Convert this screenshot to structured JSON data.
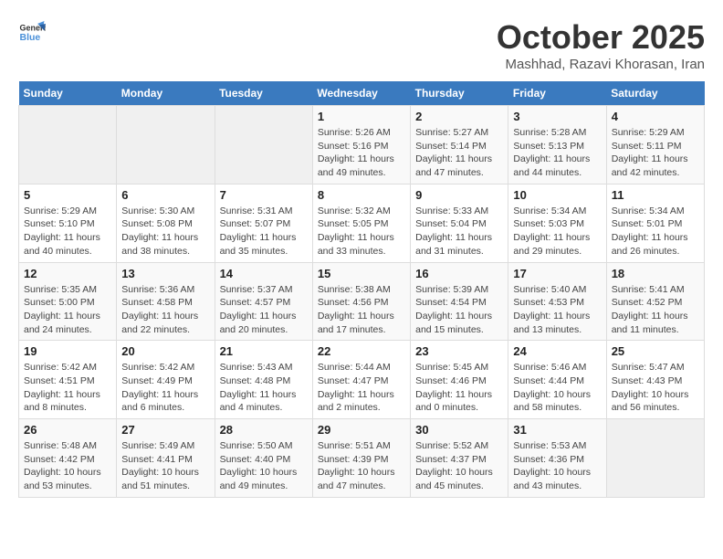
{
  "header": {
    "logo_line1": "General",
    "logo_line2": "Blue",
    "title": "October 2025",
    "subtitle": "Mashhad, Razavi Khorasan, Iran"
  },
  "days_of_week": [
    "Sunday",
    "Monday",
    "Tuesday",
    "Wednesday",
    "Thursday",
    "Friday",
    "Saturday"
  ],
  "weeks": [
    [
      {
        "day": "",
        "info": ""
      },
      {
        "day": "",
        "info": ""
      },
      {
        "day": "",
        "info": ""
      },
      {
        "day": "1",
        "info": "Sunrise: 5:26 AM\nSunset: 5:16 PM\nDaylight: 11 hours and 49 minutes."
      },
      {
        "day": "2",
        "info": "Sunrise: 5:27 AM\nSunset: 5:14 PM\nDaylight: 11 hours and 47 minutes."
      },
      {
        "day": "3",
        "info": "Sunrise: 5:28 AM\nSunset: 5:13 PM\nDaylight: 11 hours and 44 minutes."
      },
      {
        "day": "4",
        "info": "Sunrise: 5:29 AM\nSunset: 5:11 PM\nDaylight: 11 hours and 42 minutes."
      }
    ],
    [
      {
        "day": "5",
        "info": "Sunrise: 5:29 AM\nSunset: 5:10 PM\nDaylight: 11 hours and 40 minutes."
      },
      {
        "day": "6",
        "info": "Sunrise: 5:30 AM\nSunset: 5:08 PM\nDaylight: 11 hours and 38 minutes."
      },
      {
        "day": "7",
        "info": "Sunrise: 5:31 AM\nSunset: 5:07 PM\nDaylight: 11 hours and 35 minutes."
      },
      {
        "day": "8",
        "info": "Sunrise: 5:32 AM\nSunset: 5:05 PM\nDaylight: 11 hours and 33 minutes."
      },
      {
        "day": "9",
        "info": "Sunrise: 5:33 AM\nSunset: 5:04 PM\nDaylight: 11 hours and 31 minutes."
      },
      {
        "day": "10",
        "info": "Sunrise: 5:34 AM\nSunset: 5:03 PM\nDaylight: 11 hours and 29 minutes."
      },
      {
        "day": "11",
        "info": "Sunrise: 5:34 AM\nSunset: 5:01 PM\nDaylight: 11 hours and 26 minutes."
      }
    ],
    [
      {
        "day": "12",
        "info": "Sunrise: 5:35 AM\nSunset: 5:00 PM\nDaylight: 11 hours and 24 minutes."
      },
      {
        "day": "13",
        "info": "Sunrise: 5:36 AM\nSunset: 4:58 PM\nDaylight: 11 hours and 22 minutes."
      },
      {
        "day": "14",
        "info": "Sunrise: 5:37 AM\nSunset: 4:57 PM\nDaylight: 11 hours and 20 minutes."
      },
      {
        "day": "15",
        "info": "Sunrise: 5:38 AM\nSunset: 4:56 PM\nDaylight: 11 hours and 17 minutes."
      },
      {
        "day": "16",
        "info": "Sunrise: 5:39 AM\nSunset: 4:54 PM\nDaylight: 11 hours and 15 minutes."
      },
      {
        "day": "17",
        "info": "Sunrise: 5:40 AM\nSunset: 4:53 PM\nDaylight: 11 hours and 13 minutes."
      },
      {
        "day": "18",
        "info": "Sunrise: 5:41 AM\nSunset: 4:52 PM\nDaylight: 11 hours and 11 minutes."
      }
    ],
    [
      {
        "day": "19",
        "info": "Sunrise: 5:42 AM\nSunset: 4:51 PM\nDaylight: 11 hours and 8 minutes."
      },
      {
        "day": "20",
        "info": "Sunrise: 5:42 AM\nSunset: 4:49 PM\nDaylight: 11 hours and 6 minutes."
      },
      {
        "day": "21",
        "info": "Sunrise: 5:43 AM\nSunset: 4:48 PM\nDaylight: 11 hours and 4 minutes."
      },
      {
        "day": "22",
        "info": "Sunrise: 5:44 AM\nSunset: 4:47 PM\nDaylight: 11 hours and 2 minutes."
      },
      {
        "day": "23",
        "info": "Sunrise: 5:45 AM\nSunset: 4:46 PM\nDaylight: 11 hours and 0 minutes."
      },
      {
        "day": "24",
        "info": "Sunrise: 5:46 AM\nSunset: 4:44 PM\nDaylight: 10 hours and 58 minutes."
      },
      {
        "day": "25",
        "info": "Sunrise: 5:47 AM\nSunset: 4:43 PM\nDaylight: 10 hours and 56 minutes."
      }
    ],
    [
      {
        "day": "26",
        "info": "Sunrise: 5:48 AM\nSunset: 4:42 PM\nDaylight: 10 hours and 53 minutes."
      },
      {
        "day": "27",
        "info": "Sunrise: 5:49 AM\nSunset: 4:41 PM\nDaylight: 10 hours and 51 minutes."
      },
      {
        "day": "28",
        "info": "Sunrise: 5:50 AM\nSunset: 4:40 PM\nDaylight: 10 hours and 49 minutes."
      },
      {
        "day": "29",
        "info": "Sunrise: 5:51 AM\nSunset: 4:39 PM\nDaylight: 10 hours and 47 minutes."
      },
      {
        "day": "30",
        "info": "Sunrise: 5:52 AM\nSunset: 4:37 PM\nDaylight: 10 hours and 45 minutes."
      },
      {
        "day": "31",
        "info": "Sunrise: 5:53 AM\nSunset: 4:36 PM\nDaylight: 10 hours and 43 minutes."
      },
      {
        "day": "",
        "info": ""
      }
    ]
  ]
}
